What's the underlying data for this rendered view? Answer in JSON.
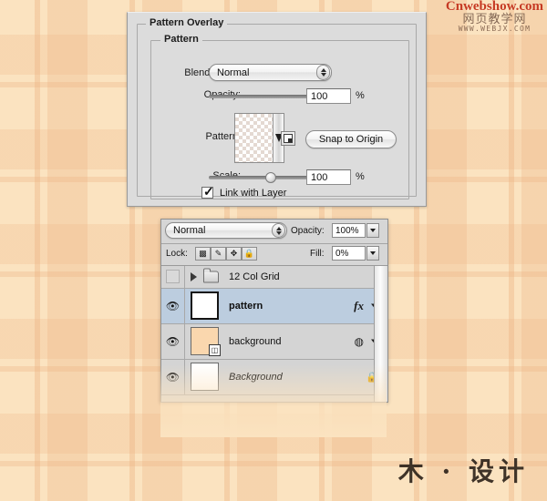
{
  "watermark": {
    "top_main": "Cnwebshow.com",
    "top_cn": "网页教学网",
    "top_url": "WWW.WEBJX.COM",
    "bottom": "木 · 设计",
    "top_color": "#c63a22"
  },
  "dialog": {
    "outer_group_label": "Pattern Overlay",
    "inner_group_label": "Pattern",
    "blend_mode": {
      "label": "Blend Mode:",
      "value": "Normal"
    },
    "opacity": {
      "label": "Opacity:",
      "value": "100",
      "unit": "%",
      "slider_percent": 100
    },
    "pattern": {
      "label": "Pattern:",
      "swatch_icon": "checkerboard-transparent-pattern",
      "dropdown_icon": "triangle-down-icon",
      "new_preset_icon": "new-preset-icon",
      "snap_button": "Snap to Origin"
    },
    "scale": {
      "label": "Scale:",
      "value": "100",
      "unit": "%",
      "slider_percent": 50
    },
    "link_with_layer": {
      "label": "Link with Layer",
      "checked": true,
      "check_glyph": "✓"
    }
  },
  "layers_panel": {
    "blend_mode_value": "Normal",
    "opacity": {
      "label": "Opacity:",
      "value": "100%"
    },
    "fill": {
      "label": "Fill:",
      "value": "0%"
    },
    "lock": {
      "label": "Lock:",
      "buttons": [
        {
          "name": "lock-transparent-pixels",
          "glyph": "▩"
        },
        {
          "name": "lock-image-pixels",
          "glyph": "✎"
        },
        {
          "name": "lock-position",
          "glyph": "✥"
        },
        {
          "name": "lock-all",
          "glyph": "🔒"
        }
      ]
    },
    "eye_glyph": "👁",
    "rows": [
      {
        "type": "group",
        "name": "12 Col Grid",
        "visible": false,
        "selected": false,
        "disclosure": "triangle-right-icon",
        "folder_icon": "folder-icon"
      },
      {
        "type": "layer",
        "name": "pattern",
        "visible": true,
        "selected": true,
        "style": "bold",
        "thumb": "white",
        "right_icon": "fx",
        "right_icon_glyph": "fx",
        "has_expand": true
      },
      {
        "type": "layer",
        "name": "background",
        "visible": true,
        "selected": false,
        "style": "normal",
        "thumb": "peach",
        "has_mask_badge": true,
        "right_icon": "smart-object",
        "right_icon_glyph": "◍",
        "has_expand": true
      },
      {
        "type": "layer",
        "name": "Background",
        "visible": true,
        "selected": false,
        "style": "italic",
        "thumb": "white",
        "right_icon": "lock",
        "right_icon_glyph": "🔒",
        "has_expand": false
      }
    ]
  },
  "colors": {
    "background_base": "#fbe3c0",
    "plaid_line": "#ecb282",
    "dialog_bg": "#dcdcdc",
    "panel_bg": "#d4d4d4",
    "selected_row": "#bccddf"
  }
}
